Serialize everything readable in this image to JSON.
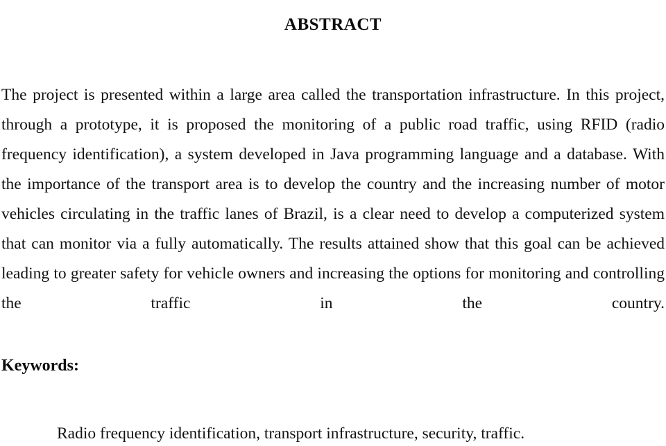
{
  "document": {
    "heading": "ABSTRACT",
    "abstract_text": "The project is presented within a large area called the transportation infrastructure. In this project, through a prototype, it is proposed the monitoring of a public road traffic, using RFID (radio frequency identification), a system developed in Java programming language and a database. With the importance of the transport area is to develop the country and the increasing number of motor vehicles circulating in the traffic lanes of Brazil, is a clear need to develop a computerized system that can monitor via a fully automatically. The results attained show that this goal can be achieved leading to greater safety for vehicle owners and increasing the options for monitoring and controlling the traffic in the country.",
    "keywords_label": "Keywords:",
    "keywords_value": "Radio frequency identification, transport infrastructure, security, traffic.",
    "colors": {
      "page_background": "#ffffff",
      "text": "#121212",
      "heading": "#0d0d0d"
    }
  }
}
